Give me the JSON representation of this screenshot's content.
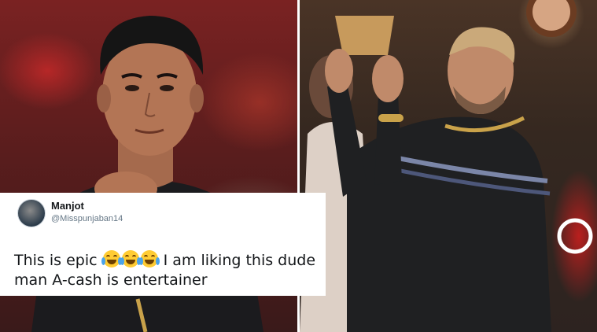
{
  "tweet": {
    "name": "Manjot",
    "handle": "@Misspunjaban14",
    "text_before": "This is epic ",
    "emoji": "face-with-tears-of-joy",
    "text_after": " I am liking this dude man A-cash is entertainer"
  },
  "colors": {
    "name": "#14171a",
    "handle": "#657786",
    "emoji": "#ffcc33"
  }
}
